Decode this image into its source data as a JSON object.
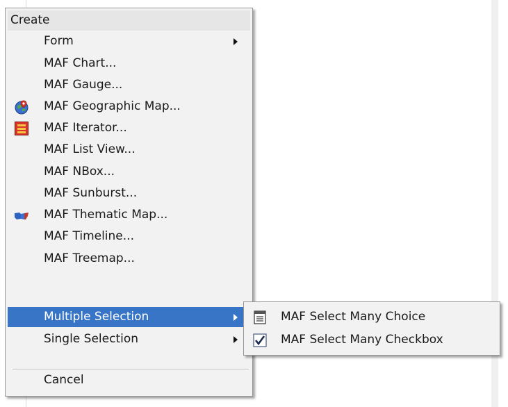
{
  "menu": {
    "header": "Create",
    "items": [
      {
        "label": "Form",
        "has_submenu": true
      },
      {
        "label": "MAF Chart..."
      },
      {
        "label": "MAF Gauge..."
      },
      {
        "label": "MAF Geographic Map...",
        "icon": "geographic-map-icon"
      },
      {
        "label": "MAF Iterator...",
        "icon": "iterator-icon"
      },
      {
        "label": "MAF List View..."
      },
      {
        "label": "MAF NBox..."
      },
      {
        "label": "MAF Sunburst..."
      },
      {
        "label": "MAF Thematic Map...",
        "icon": "thematic-map-icon"
      },
      {
        "label": "MAF Timeline..."
      },
      {
        "label": "MAF Treemap..."
      },
      {
        "label": "Multiple Selection",
        "has_submenu": true,
        "selected": true
      },
      {
        "label": "Single Selection",
        "has_submenu": true
      }
    ],
    "cancel": "Cancel"
  },
  "submenu": {
    "items": [
      {
        "label": "MAF Select Many Choice",
        "icon": "select-choice-icon"
      },
      {
        "label": "MAF Select Many Checkbox",
        "icon": "checkbox-checked-icon"
      }
    ]
  },
  "colors": {
    "selected_bg": "#3875c7",
    "menu_bg": "#f2f2f2",
    "header_bg": "#e6e6e6"
  }
}
